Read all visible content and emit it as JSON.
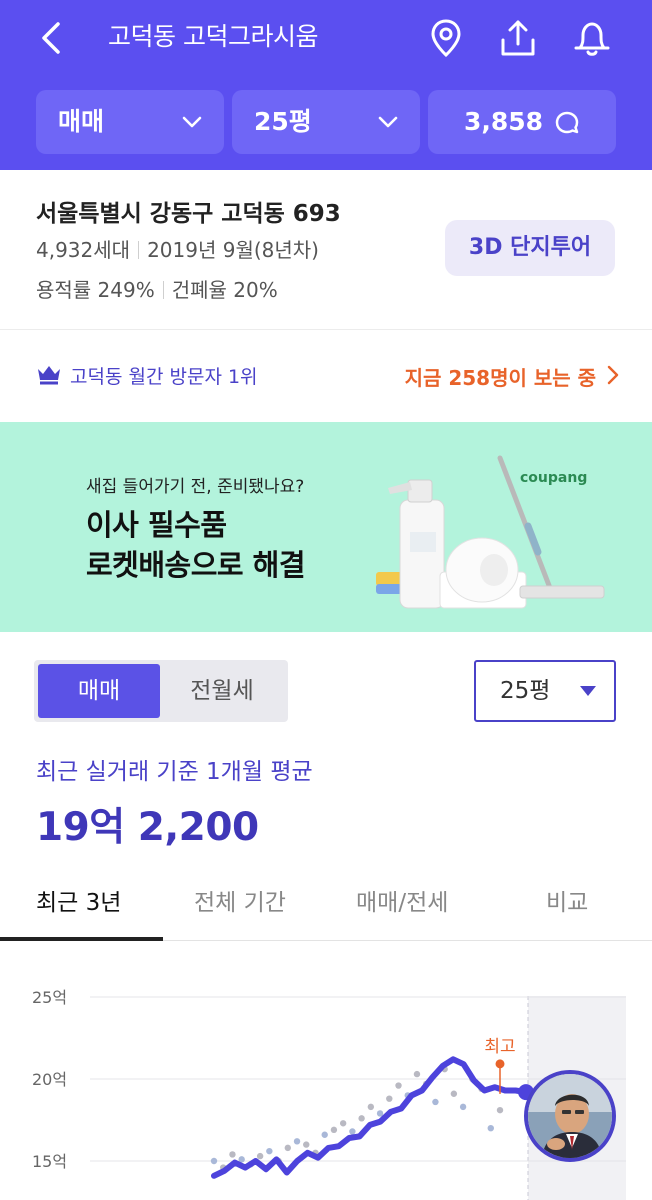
{
  "header": {
    "title": "고덕동 고덕그라시움",
    "icons": [
      "back-icon",
      "location-pin-icon",
      "share-icon",
      "bell-icon"
    ],
    "filters": {
      "trade_type": "매매",
      "size": "25평",
      "comments": "3,858"
    }
  },
  "info": {
    "address": "서울특별시 강동구 고덕동 693",
    "households": "4,932세대",
    "built": "2019년 9월(8년차)",
    "floor_area_ratio": "용적률 249%",
    "coverage_ratio": "건폐율 20%",
    "tour_button": "3D 단지투어"
  },
  "rank": {
    "text": "고덕동 월간 방문자 1위",
    "viewing": "지금 258명이 보는 중"
  },
  "ad": {
    "small": "새집 들어가기 전, 준비됐나요?",
    "line1": "이사 필수품",
    "line2": "로켓배송으로 해결",
    "brand": "coupang"
  },
  "toggle": {
    "option_a": "매매",
    "option_b": "전월세",
    "selected": "매매"
  },
  "size_select": "25평",
  "average": {
    "label": "최근 실거래 기준 1개월 평균",
    "price": "19억 2,200"
  },
  "tabs": [
    "최근 3년",
    "전체 기간",
    "매매/전세",
    "비교"
  ],
  "colors": {
    "brand": "#5b4ff0",
    "accent": "#4a42c8",
    "highlight": "#e8632a",
    "banner": "#b3f3dc"
  },
  "chart_data": {
    "type": "line",
    "y_unit": "억",
    "ylabels": [
      "25억",
      "20억",
      "15억"
    ],
    "ylim": [
      14,
      26
    ],
    "annotation": "최고",
    "annotation_value": 20.8,
    "series": [
      {
        "values": [
          14.1,
          14.4,
          14.9,
          14.6,
          15.0,
          14.5,
          15.1,
          14.3,
          15.0,
          15.5,
          15.2,
          15.8,
          15.9,
          16.4,
          16.5,
          17.2,
          17.4,
          18.0,
          18.2,
          19.0,
          19.3,
          20.1,
          20.8,
          21.2,
          20.9,
          19.9,
          19.3,
          19.5,
          19.3,
          19.3,
          19.2
        ]
      }
    ],
    "scatter_points": [
      15.0,
      14.6,
      15.4,
      15.1,
      14.8,
      15.3,
      15.6,
      15.0,
      15.8,
      16.2,
      16.0,
      15.5,
      16.6,
      16.9,
      17.3,
      16.8,
      17.6,
      18.3,
      17.9,
      18.8,
      19.6,
      19.0,
      20.3,
      19.7,
      18.6,
      20.6,
      19.1,
      18.3,
      20.0,
      19.4,
      17.0,
      18.1
    ]
  }
}
